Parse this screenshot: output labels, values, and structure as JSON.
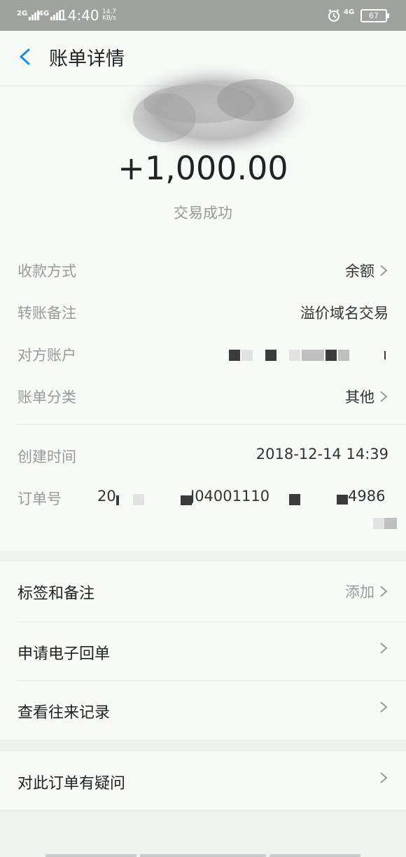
{
  "status_bar": {
    "signal_1": "2G",
    "signal_2": "4G",
    "time": "14:40",
    "speed_value": "14.7",
    "speed_unit": "KB/s",
    "network": "4G",
    "battery": "67"
  },
  "header": {
    "title": "账单详情"
  },
  "summary": {
    "amount": "+1,000.00",
    "status": "交易成功"
  },
  "details": {
    "payment_method_label": "收款方式",
    "payment_method_value": "余额",
    "transfer_note_label": "转账备注",
    "transfer_note_value": "溢价域名交易",
    "counterparty_label": "对方账户",
    "category_label": "账单分类",
    "category_value": "其他",
    "created_time_label": "创建时间",
    "created_time_value": "2018-12-14 14:39",
    "order_no_label": "订单号",
    "order_no_part1": "20",
    "order_no_part2": "J04001110",
    "order_no_part3": "4986"
  },
  "actions": {
    "tags_label": "标签和备注",
    "tags_action": "添加",
    "receipt_label": "申请电子回单",
    "history_label": "查看往来记录",
    "question_label": "对此订单有疑问"
  },
  "colors": {
    "accent": "#1a8fe0",
    "status_bar": "#9fa3a0",
    "card_bg": "#f6fbf7",
    "page_bg": "#eef3ef"
  }
}
